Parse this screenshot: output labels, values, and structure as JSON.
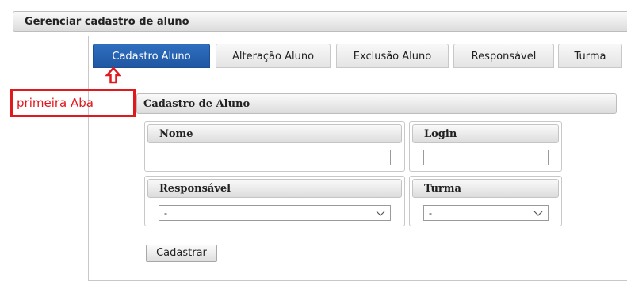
{
  "header": {
    "title": "Gerenciar cadastro de aluno"
  },
  "tabs": [
    {
      "label": "Cadastro Aluno",
      "active": true
    },
    {
      "label": "Alteração Aluno",
      "active": false
    },
    {
      "label": "Exclusão Aluno",
      "active": false
    },
    {
      "label": "Responsável",
      "active": false
    },
    {
      "label": "Turma",
      "active": false
    }
  ],
  "annotation": {
    "text": "primeira Aba",
    "color": "#e0191f",
    "icon": "arrow-up-icon"
  },
  "form": {
    "section_title": "Cadastro de Aluno",
    "nome": {
      "label": "Nome",
      "value": "",
      "placeholder": ""
    },
    "login": {
      "label": "Login",
      "value": "",
      "placeholder": ""
    },
    "responsavel": {
      "label": "Responsável",
      "selected": "-"
    },
    "turma": {
      "label": "Turma",
      "selected": "-"
    },
    "submit_label": "Cadastrar"
  },
  "colors": {
    "active_tab": "#2f6fbf"
  }
}
